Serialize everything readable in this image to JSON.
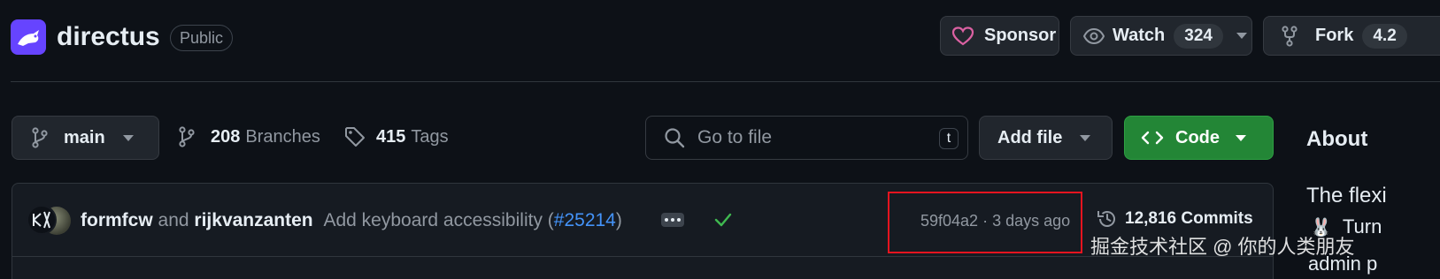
{
  "repo": {
    "name": "directus",
    "visibility": "Public"
  },
  "actions": {
    "sponsor_label": "Sponsor",
    "watch_label": "Watch",
    "watch_count": "324",
    "fork_label": "Fork",
    "fork_count": "4.2"
  },
  "toolbar": {
    "branch": "main",
    "branches_count": "208",
    "branches_label": "Branches",
    "tags_count": "415",
    "tags_label": "Tags",
    "search_placeholder": "Go to file",
    "search_shortcut": "t",
    "add_file_label": "Add file",
    "code_label": "Code"
  },
  "commit": {
    "author1": "formfcw",
    "and_text": "and",
    "author2": "rijkvanzanten",
    "message": "Add keyboard accessibility (",
    "pr_link": "#25214",
    "message_end": ")",
    "sha": "59f04a2",
    "separator": "·",
    "time": "3 days ago",
    "commits_count": "12,816 Commits"
  },
  "about": {
    "heading": "About",
    "desc_partial": "The flexi",
    "line2_partial": "Turn",
    "line3_partial": "admin p"
  },
  "watermark": "掘金技术社区 @ 你的人类朋友",
  "colors": {
    "bg": "#0d1117",
    "accent_green": "#238636",
    "link_blue": "#4493f8",
    "highlight_red": "#e5141f",
    "sponsor_pink": "#db61a2",
    "check_green": "#3fb950"
  }
}
